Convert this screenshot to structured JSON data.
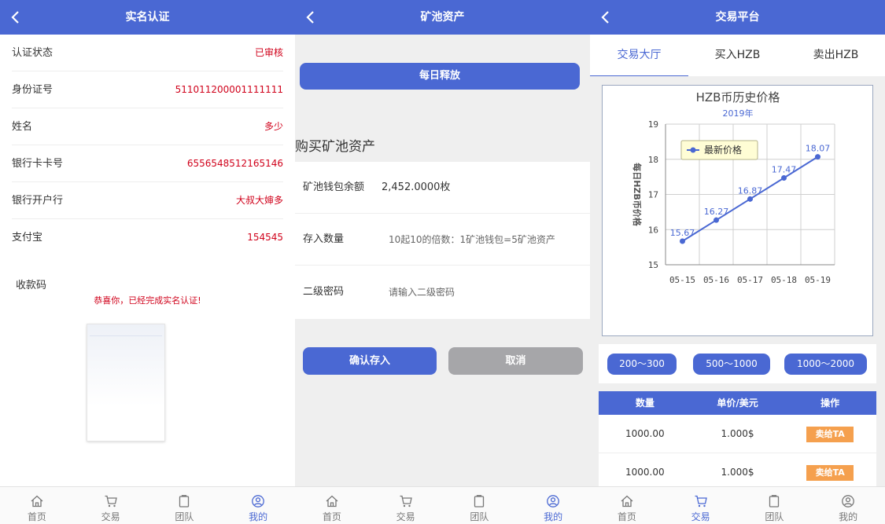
{
  "verification": {
    "title": "实名认证",
    "rows": [
      {
        "label": "认证状态",
        "value": "已审核"
      },
      {
        "label": "身份证号",
        "value": "511011200001111111"
      },
      {
        "label": "姓名",
        "value": "多少"
      },
      {
        "label": "银行卡卡号",
        "value": "6556548512165146"
      },
      {
        "label": "银行开户行",
        "value": "大叔大婶多"
      },
      {
        "label": "支付宝",
        "value": "154545"
      }
    ],
    "qr_label": "收款码",
    "congrats": "恭喜你，已经完成实名认证!"
  },
  "mining": {
    "title": "矿池资产",
    "daily_button": "每日释放",
    "section_title": "购买矿池资产",
    "balance_label": "矿池钱包余额",
    "balance_value": "2,452.0000枚",
    "deposit_label": "存入数量",
    "deposit_placeholder": "10起10的倍数：1矿池钱包=5矿池资产",
    "password_label": "二级密码",
    "password_placeholder": "请输入二级密码",
    "confirm_button": "确认存入",
    "cancel_button": "取消"
  },
  "trading": {
    "title": "交易平台",
    "tabs": [
      "交易大厅",
      "买入HZB",
      "卖出HZB"
    ],
    "price_ranges": [
      "200～300",
      "500～1000",
      "1000～2000"
    ],
    "table": {
      "headers": [
        "数量",
        "单价/美元",
        "操作"
      ],
      "rows": [
        {
          "qty": "1000.00",
          "price": "1.000$",
          "action": "卖给TA"
        },
        {
          "qty": "1000.00",
          "price": "1.000$",
          "action": "卖给TA"
        }
      ]
    }
  },
  "chart_data": {
    "type": "line",
    "title": "HZB币历史价格",
    "subtitle": "2019年",
    "ylabel": "每日HZB币价格",
    "xlabel": "",
    "categories": [
      "05-15",
      "05-16",
      "05-17",
      "05-18",
      "05-19"
    ],
    "series": [
      {
        "name": "最新价格",
        "values": [
          15.67,
          16.27,
          16.87,
          17.47,
          18.07
        ]
      }
    ],
    "data_labels": [
      "15.67",
      "16.27",
      "16.87",
      "17.47",
      "18.07"
    ],
    "ylim": [
      15,
      19
    ],
    "yticks": [
      "15",
      "16",
      "17",
      "18",
      "19"
    ],
    "grid": true,
    "legend": "top-left",
    "color": "#4a68d3"
  },
  "tabbar": {
    "items": [
      "首页",
      "交易",
      "团队",
      "我的"
    ]
  },
  "colors": {
    "primary": "#4a68d3",
    "value_red": "#d0021b",
    "cancel_gray": "#a6a6a9",
    "sell_orange": "#f5a04e"
  }
}
